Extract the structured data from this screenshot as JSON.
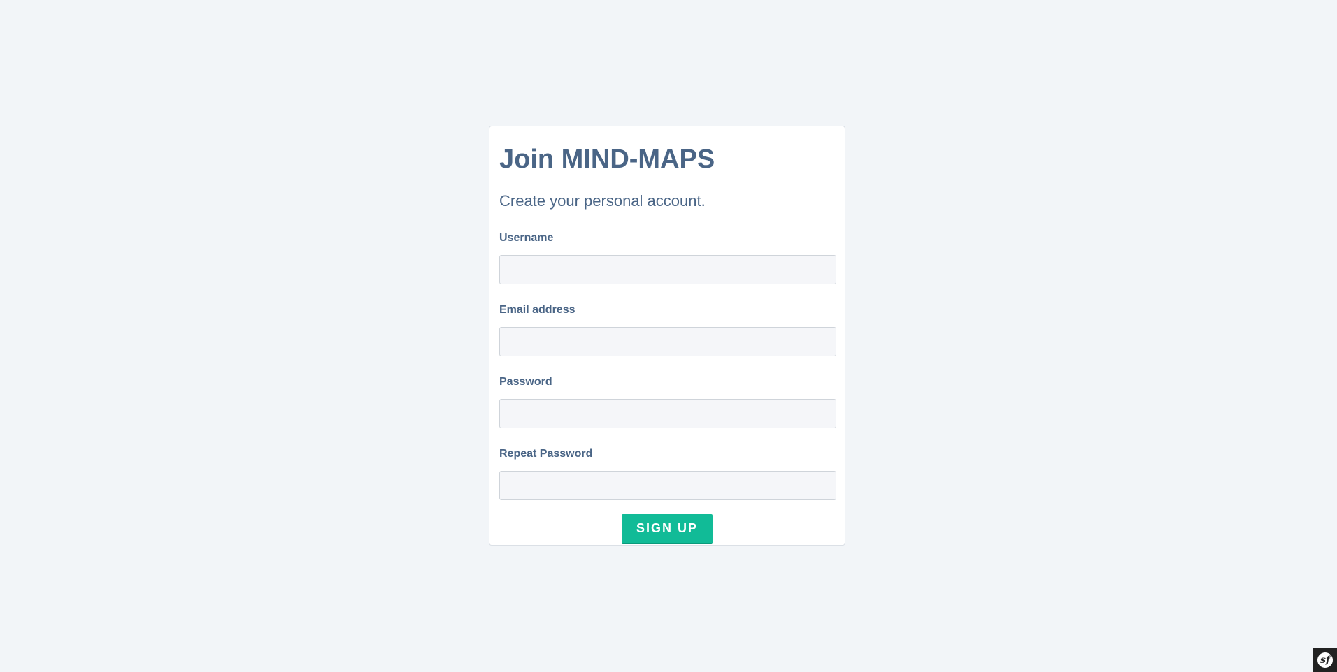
{
  "form": {
    "title": "Join MIND-MAPS",
    "subtitle": "Create your personal account.",
    "fields": [
      {
        "label": "Username",
        "value": "",
        "type": "text"
      },
      {
        "label": "Email address",
        "value": "",
        "type": "email"
      },
      {
        "label": "Password",
        "value": "",
        "type": "password"
      },
      {
        "label": "Repeat Password",
        "value": "",
        "type": "password"
      }
    ],
    "submit_label": "SIGN UP"
  },
  "debug_toolbar": {
    "icon": "symfony-logo-icon",
    "glyph": "sf"
  },
  "colors": {
    "background": "#f2f5f8",
    "text": "#4a6586",
    "accent": "#11bb97"
  }
}
